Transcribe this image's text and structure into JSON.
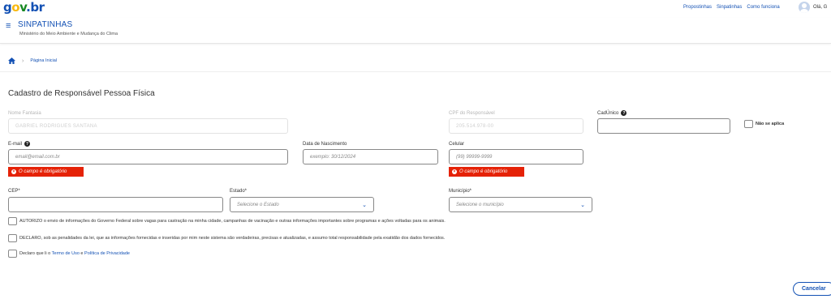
{
  "header": {
    "logo_parts": {
      "g": "g",
      "o": "o",
      "v": "v",
      "dot": ".",
      "br": "br"
    },
    "links": [
      "Propostinhas",
      "Sinpatinhas",
      "Como funciona"
    ],
    "greeting": "Olá, G",
    "app_name": "SINPATINHAS",
    "ministry": "Ministério do Meio Ambiente e Mudança do Clima",
    "menu_icon": "≡"
  },
  "breadcrumb": {
    "home_icon": "home-icon",
    "separator": "›",
    "current": "Página Inicial"
  },
  "form": {
    "title": "Cadastro de Responsável Pessoa Física",
    "nome_fantasia": {
      "label": "Nome Fantasia",
      "value": "GABRIEL RODRIGUES SANTANA"
    },
    "cpf": {
      "label": "CPF do Responsável",
      "value": "205.514.978-00"
    },
    "cadunico": {
      "label": "CadÚnico",
      "value": ""
    },
    "nao_se_aplica": {
      "label": "Não se aplica"
    },
    "email": {
      "label": "E-mail",
      "placeholder": "email@email.com.br",
      "error": "O campo é obrigatório"
    },
    "nascimento": {
      "label": "Data de Nascimento",
      "placeholder": "exemplo: 30/12/2024"
    },
    "celular": {
      "label": "Celular",
      "placeholder": "(99) 99999-9999",
      "error": "O campo é obrigatório"
    },
    "cep": {
      "label": "CEP*",
      "value": ""
    },
    "estado": {
      "label": "Estado*",
      "selected": "Selecione o Estado"
    },
    "municipio": {
      "label": "Município*",
      "selected": "Selecione o município"
    },
    "check_autorizo": "AUTORIZO o envio de informações do Governo Federal sobre vagas para castração na minha cidade, campanhas de vacinação e outras informações importantes sobre programas e ações voltadas para os animais.",
    "check_declaro": "DECLARO, sob as penalidades da lei, que as informações fornecidas e inseridas por mim neste sistema são verdadeiras, precisas e atualizadas, e assumo total responsabilidade pela exatidão dos dados fornecidos.",
    "check_termo": {
      "prefix": "Declaro que li o ",
      "termo": "Termo de Uso",
      "e": " e ",
      "politica": "Política de Privacidade"
    },
    "cancel_label": "Cancelar"
  },
  "colors": {
    "primary": "#1351b4",
    "error": "#e52207",
    "logo_yellow": "#f8b911",
    "logo_green": "#168821"
  }
}
